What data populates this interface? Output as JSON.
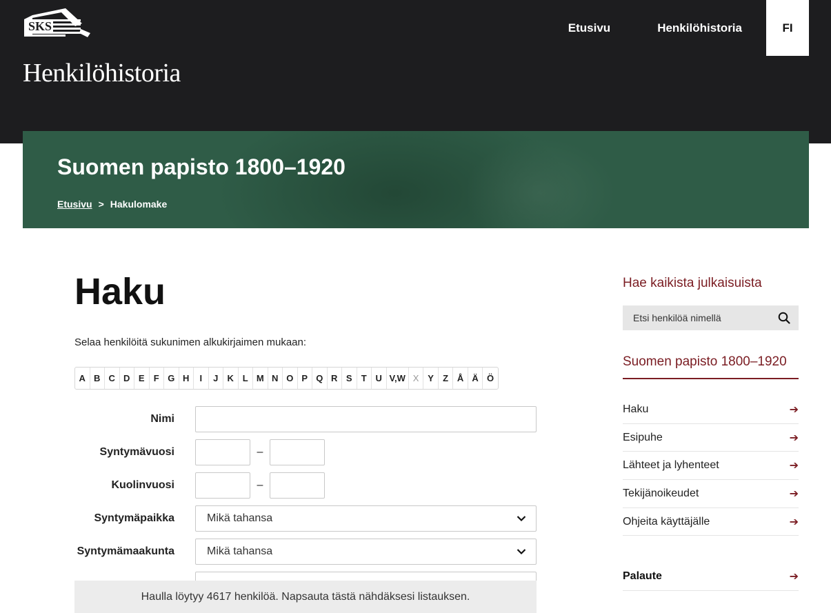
{
  "header": {
    "logo_text": "SKS",
    "site_title": "Henkilöhistoria",
    "nav": [
      "Etusivu",
      "Henkilöhistoria"
    ],
    "language": "FI"
  },
  "banner": {
    "title": "Suomen papisto 1800–1920",
    "breadcrumb_home": "Etusivu",
    "breadcrumb_separator": ">",
    "breadcrumb_current": "Hakulomake"
  },
  "main": {
    "title": "Haku",
    "browse_label": "Selaa henkilöitä sukunimen alkukirjaimen mukaan:",
    "letters": [
      "A",
      "B",
      "C",
      "D",
      "E",
      "F",
      "G",
      "H",
      "I",
      "J",
      "K",
      "L",
      "M",
      "N",
      "O",
      "P",
      "Q",
      "R",
      "S",
      "T",
      "U",
      "V,W",
      "X",
      "Y",
      "Z",
      "Å",
      "Ä",
      "Ö"
    ],
    "disabled_letters": [
      "X"
    ],
    "form": {
      "name_label": "Nimi",
      "birth_year_label": "Syntymävuosi",
      "death_year_label": "Kuolinvuosi",
      "year_separator": "–",
      "birthplace_label": "Syntymäpaikka",
      "birthplace_value": "Mikä tahansa",
      "birth_province_label": "Syntymämaakunta",
      "birth_province_value": "Mikä tahansa"
    },
    "result_text": "Haulla löytyy 4617 henkilöä. Napsauta tästä nähdäksesi listauksen."
  },
  "sidebar": {
    "search_title": "Hae kaikista julkaisuista",
    "search_placeholder": "Etsi henkilöä nimellä",
    "section_title": "Suomen papisto 1800–1920",
    "links": [
      "Haku",
      "Esipuhe",
      "Lähteet ja lyhenteet",
      "Tekijänoikeudet",
      "Ohjeita käyttäjälle"
    ],
    "feedback": "Palaute"
  },
  "colors": {
    "header_bg": "#1d1d1f",
    "banner_green": "#2f5c47",
    "accent": "#7a1c22"
  },
  "icons": {
    "search": "magnifier-icon",
    "arrow": "arrow-right-icon",
    "chevron": "chevron-down-icon"
  }
}
